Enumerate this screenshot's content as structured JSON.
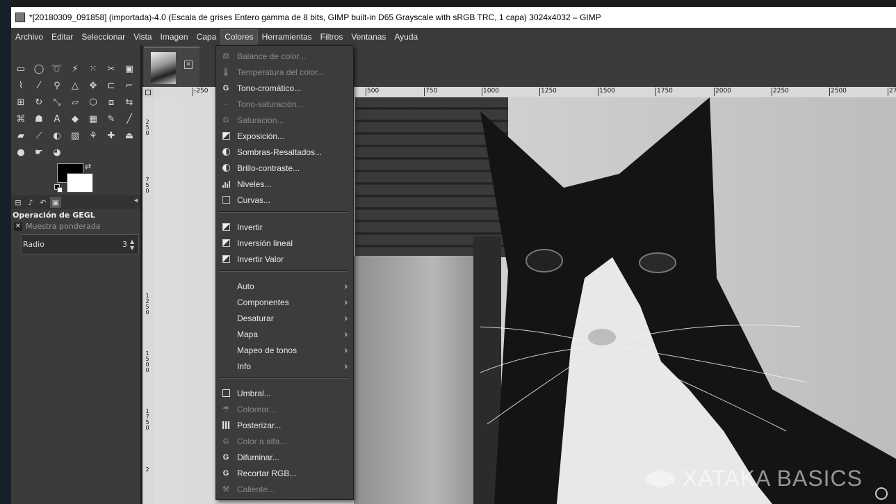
{
  "window": {
    "title": "*[20180309_091858] (importada)-4.0 (Escala de grises Entero gamma de 8 bits, GIMP built-in D65 Grayscale with sRGB TRC, 1 capa) 3024x4032 – GIMP"
  },
  "menubar": {
    "items": [
      "Archivo",
      "Editar",
      "Seleccionar",
      "Vista",
      "Imagen",
      "Capa",
      "Colores",
      "Herramientas",
      "Filtros",
      "Ventanas",
      "Ayuda"
    ],
    "active": "Colores"
  },
  "tool_options": {
    "title": "Operación de GEGL",
    "checkbox_label": "Muestra ponderada",
    "radio_label": "Radio",
    "radio_value": "3"
  },
  "ruler": {
    "h_ticks": [
      "-250",
      "500",
      "750",
      "1000",
      "1250",
      "1500",
      "1750",
      "2000",
      "2250",
      "2500",
      "27"
    ],
    "v_ticks": [
      "250",
      "750",
      "1250",
      "1500",
      "1750",
      "2"
    ]
  },
  "watermark": "XATAKA BASICS",
  "colors_menu": {
    "items": [
      {
        "label": "Balance de color...",
        "disabled": true,
        "icon": "balance-icon"
      },
      {
        "label": "Temperatura del color...",
        "disabled": true,
        "icon": "temperature-icon"
      },
      {
        "label": "Tono-cromático...",
        "disabled": false,
        "icon": "gegl-icon"
      },
      {
        "label": "Tono-saturación...",
        "disabled": true,
        "icon": "hue-saturation-icon"
      },
      {
        "label": "Saturación...",
        "disabled": true,
        "icon": "gegl-icon"
      },
      {
        "label": "Exposición...",
        "disabled": false,
        "icon": "exposure-icon"
      },
      {
        "label": "Sombras-Resaltados...",
        "disabled": false,
        "icon": "shadows-icon"
      },
      {
        "label": "Brillo-contraste...",
        "disabled": false,
        "icon": "brightness-icon"
      },
      {
        "label": "Niveles...",
        "disabled": false,
        "icon": "levels-icon"
      },
      {
        "label": "Curvas...",
        "disabled": false,
        "icon": "curves-icon"
      },
      {
        "label": "Invertir",
        "disabled": false,
        "icon": "invert-icon"
      },
      {
        "label": "Inversión lineal",
        "disabled": false,
        "icon": "invert-icon"
      },
      {
        "label": "Invertir Valor",
        "disabled": false,
        "icon": "invert-icon"
      },
      {
        "label": "Auto",
        "disabled": false,
        "submenu": true
      },
      {
        "label": "Componentes",
        "disabled": false,
        "submenu": true
      },
      {
        "label": "Desaturar",
        "disabled": false,
        "submenu": true
      },
      {
        "label": "Mapa",
        "disabled": false,
        "submenu": true
      },
      {
        "label": "Mapeo de tonos",
        "disabled": false,
        "submenu": true
      },
      {
        "label": "Info",
        "disabled": false,
        "submenu": true
      },
      {
        "label": "Umbral...",
        "disabled": false,
        "icon": "threshold-icon"
      },
      {
        "label": "Colorear...",
        "disabled": true,
        "icon": "colorize-icon"
      },
      {
        "label": "Posterizar...",
        "disabled": false,
        "icon": "posterize-icon"
      },
      {
        "label": "Color a alfa...",
        "disabled": true,
        "icon": "gegl-icon"
      },
      {
        "label": "Difuminar...",
        "disabled": false,
        "icon": "gegl-icon"
      },
      {
        "label": "Recortar RGB...",
        "disabled": false,
        "icon": "gegl-icon"
      },
      {
        "label": "Caliente...",
        "disabled": true,
        "icon": "hot-icon"
      }
    ]
  }
}
